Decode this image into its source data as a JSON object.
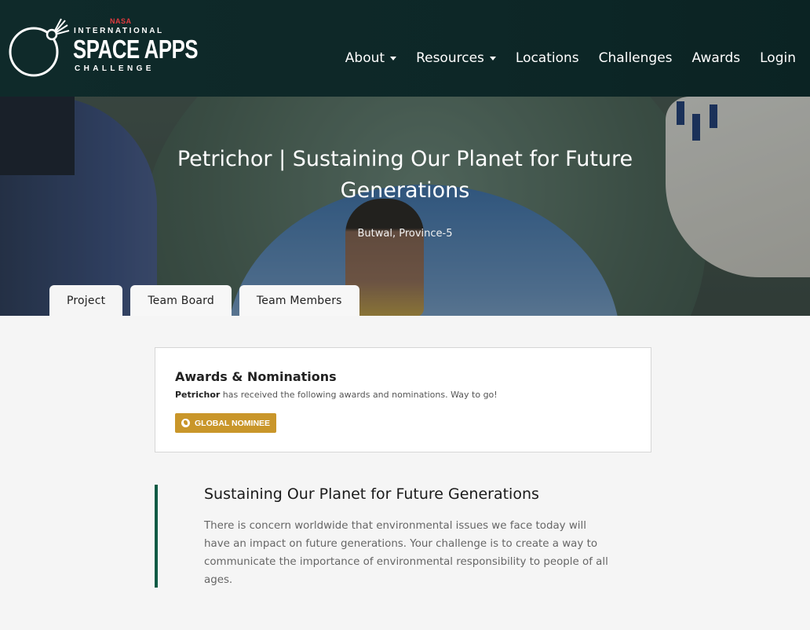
{
  "logo": {
    "nasa": "NASA",
    "line1": "INTERNATIONAL",
    "line2": "SPACE APPS",
    "line3": "CHALLENGE"
  },
  "nav": {
    "items": [
      {
        "label": "About",
        "dropdown": true
      },
      {
        "label": "Resources",
        "dropdown": true
      },
      {
        "label": "Locations",
        "dropdown": false
      },
      {
        "label": "Challenges",
        "dropdown": false
      },
      {
        "label": "Awards",
        "dropdown": false
      },
      {
        "label": "Login",
        "dropdown": false
      }
    ]
  },
  "hero": {
    "title": "Petrichor | Sustaining Our Planet for Future Generations",
    "location": "Butwal, Province-5"
  },
  "tabs": [
    {
      "label": "Project",
      "active": true
    },
    {
      "label": "Team Board",
      "active": false
    },
    {
      "label": "Team Members",
      "active": false
    }
  ],
  "awards": {
    "heading": "Awards & Nominations",
    "team_name": "Petrichor",
    "text": " has received the following awards and nominations. Way to go!",
    "badge": "GLOBAL NOMINEE",
    "badge_color": "#c9962a"
  },
  "challenge": {
    "title": "Sustaining Our Planet for Future Generations",
    "description": "There is concern worldwide that environmental issues we face today will have an impact on future generations. Your challenge is to create a way to communicate the importance of environmental responsibility to people of all ages.",
    "accent_color": "#0e5a44"
  }
}
